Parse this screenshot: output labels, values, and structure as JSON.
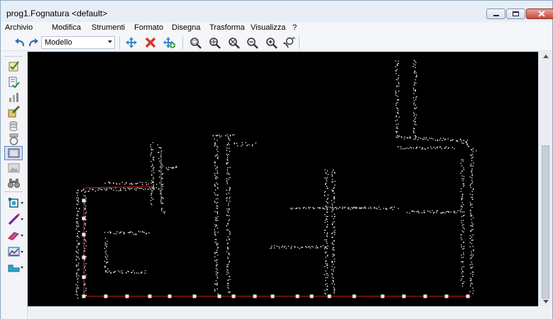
{
  "window": {
    "title": "prog1.Fognatura <default>"
  },
  "menubar": {
    "items": [
      "Archivio",
      "Modifica",
      "Strumenti",
      "Formato",
      "Disegna",
      "Trasforma",
      "Visualizza",
      "?"
    ]
  },
  "toolbar": {
    "layout_select": "Modello",
    "icons": [
      "undo-icon",
      "redo-icon",
      "move-icon",
      "delete-icon",
      "add-icon",
      "zoom-window-icon",
      "zoom-pan-icon",
      "zoom-extents-icon",
      "zoom-out-icon",
      "zoom-in-icon",
      "zoom-realtime-icon"
    ]
  },
  "left_toolbar": {
    "icons": [
      "check-icon",
      "document-check-icon",
      "chart-icon",
      "pencil-edit-icon",
      "layers-icon",
      "ring-icon",
      "window-icon",
      "picture-icon",
      "binoculars-icon",
      "node-tool-icon",
      "pipe-tool-icon",
      "eraser-tool-icon",
      "profile-tool-icon",
      "section-tool-icon"
    ]
  },
  "colors": {
    "canvas_background": "#000000",
    "drawing_points": "#ffffff",
    "pipe_line": "#cc2020",
    "window_frame": "#eef2f7"
  }
}
